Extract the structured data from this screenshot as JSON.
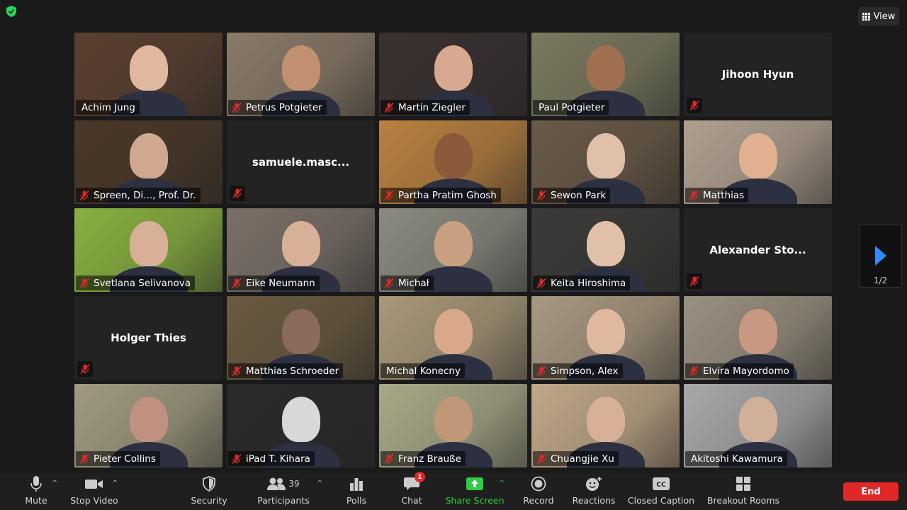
{
  "view_label": "View",
  "participants": [
    {
      "name": "Achim Jung",
      "muted": false,
      "video": true,
      "bg": "#5a4030",
      "skin": "#e0b8a0"
    },
    {
      "name": "Petrus Potgieter",
      "muted": true,
      "video": true,
      "bg": "#8a7a68",
      "skin": "#c09070"
    },
    {
      "name": "Martin Ziegler",
      "muted": true,
      "video": true,
      "bg": "#3a3030",
      "skin": "#d8a890"
    },
    {
      "name": "Paul Potgieter",
      "muted": false,
      "video": true,
      "bg": "#7a7a60",
      "skin": "#a07050"
    },
    {
      "name": "Jihoon Hyun",
      "muted": true,
      "video": false
    },
    {
      "name": "Spreen, Di..., Prof. Dr.",
      "muted": true,
      "video": true,
      "bg": "#4a3828",
      "skin": "#d0a890"
    },
    {
      "name": "samuele.masc...",
      "muted": true,
      "video": false
    },
    {
      "name": "Partha Pratim Ghosh",
      "muted": true,
      "video": true,
      "bg": "#b88040",
      "skin": "#8a5a3a"
    },
    {
      "name": "Sewon Park",
      "muted": true,
      "video": true,
      "bg": "#6a5a48",
      "skin": "#e0c0a8"
    },
    {
      "name": "Matthias",
      "muted": true,
      "video": true,
      "bg": "#b0a090",
      "skin": "#e0b090"
    },
    {
      "name": "Svetlana Selivanova",
      "muted": true,
      "video": true,
      "bg": "#88b040",
      "skin": "#d8b098"
    },
    {
      "name": "Eike Neumann",
      "muted": true,
      "video": true,
      "bg": "#7a7068",
      "skin": "#d8b098"
    },
    {
      "name": "Michał",
      "muted": true,
      "video": true,
      "bg": "#8a8a80",
      "skin": "#c8a080"
    },
    {
      "name": "Keita Hiroshima",
      "muted": true,
      "video": true,
      "bg": "#3a3a38",
      "skin": "#e0c0a8"
    },
    {
      "name": "Alexander Sto...",
      "muted": true,
      "video": false
    },
    {
      "name": "Holger Thies",
      "muted": true,
      "video": false
    },
    {
      "name": "Matthias Schroeder",
      "muted": true,
      "video": true,
      "bg": "#6a5a40",
      "skin": "#8a6a58"
    },
    {
      "name": "Michal Konecny",
      "muted": false,
      "video": true,
      "bg": "#a89878",
      "skin": "#d8a888"
    },
    {
      "name": "Simpson, Alex",
      "muted": true,
      "video": true,
      "bg": "#a89880",
      "skin": "#e0b8a0"
    },
    {
      "name": "Elvira Mayordomo",
      "muted": true,
      "video": true,
      "bg": "#9a9080",
      "skin": "#c89880"
    },
    {
      "name": "Pieter Collins",
      "muted": true,
      "video": true,
      "bg": "#a09a80",
      "skin": "#c09080"
    },
    {
      "name": "iPad T. Kihara",
      "muted": true,
      "video": true,
      "bg": "#2a2a2a",
      "skin": "#d8d8d8"
    },
    {
      "name": "Franz Brauße",
      "muted": true,
      "video": true,
      "bg": "#a8a888",
      "skin": "#c09878"
    },
    {
      "name": "Chuangjie Xu",
      "muted": true,
      "video": true,
      "bg": "#c0a888",
      "skin": "#d8b098"
    },
    {
      "name": "Akitoshi Kawamura",
      "muted": false,
      "video": true,
      "bg": "#a8a8a8",
      "skin": "#d0b098"
    }
  ],
  "pager": {
    "label": "1/2"
  },
  "toolbar": {
    "mute": "Mute",
    "stop_video": "Stop Video",
    "security": "Security",
    "participants": "Participants",
    "participants_count": "39",
    "polls": "Polls",
    "chat": "Chat",
    "chat_badge": "1",
    "share_screen": "Share Screen",
    "record": "Record",
    "reactions": "Reactions",
    "closed_caption": "Closed Caption",
    "breakout_rooms": "Breakout Rooms",
    "end": "End"
  },
  "colors": {
    "accent_green": "#23d959",
    "share_green": "#2ecc40",
    "end_red": "#e02828",
    "mute_red": "#e02828",
    "pager_blue": "#2d8cff"
  }
}
